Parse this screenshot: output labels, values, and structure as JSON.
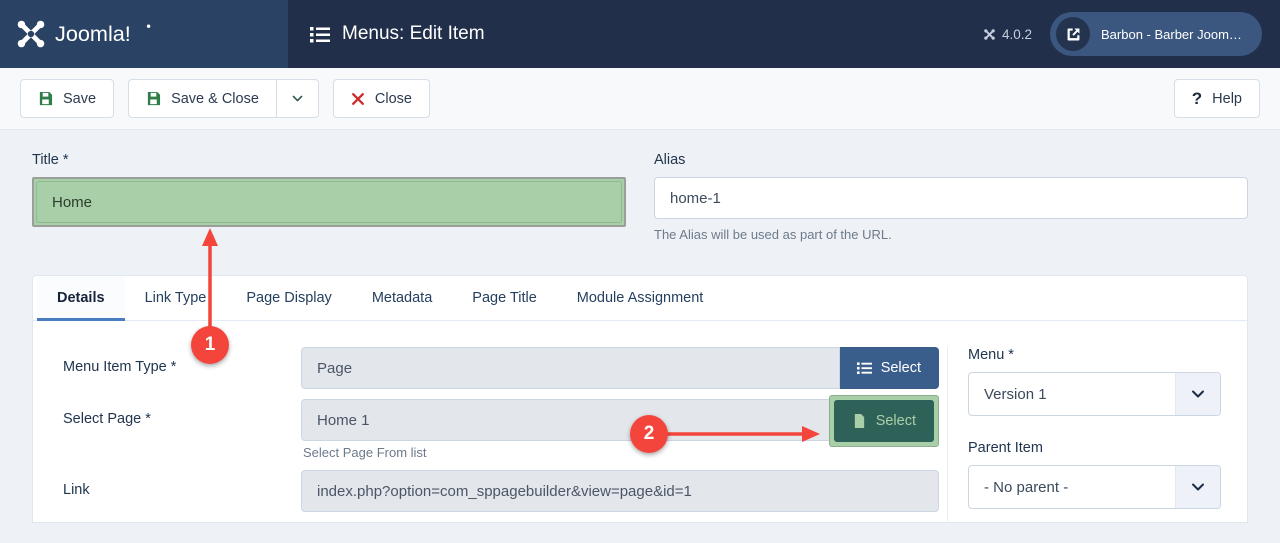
{
  "header": {
    "brand_name": "Joomla!",
    "brand_icon": "joomla-logo-icon",
    "page_title": "Menus: Edit Item",
    "page_title_icon": "list-icon",
    "version": "4.0.2",
    "version_icon": "joomla-mark-icon",
    "site_name": "Barbon - Barber Joomla Templ...",
    "site_icon": "external-link-icon"
  },
  "toolbar": {
    "save_label": "Save",
    "save_icon": "floppy-disk-icon",
    "save_close_label": "Save & Close",
    "save_close_icon": "floppy-disk-icon",
    "dropdown_icon": "chevron-down-icon",
    "close_label": "Close",
    "close_icon": "x-mark-icon",
    "help_label": "Help",
    "help_icon": "question-mark-icon"
  },
  "form": {
    "title_label": "Title *",
    "title_value": "Home",
    "title_placeholder": "Title",
    "alias_label": "Alias",
    "alias_value": "home-1",
    "alias_placeholder": "Alias",
    "alias_hint": "The Alias will be used as part of the URL."
  },
  "tabs": [
    {
      "label": "Details",
      "active": true
    },
    {
      "label": "Link Type",
      "active": false
    },
    {
      "label": "Page Display",
      "active": false
    },
    {
      "label": "Metadata",
      "active": false
    },
    {
      "label": "Page Title",
      "active": false
    },
    {
      "label": "Module Assignment",
      "active": false
    }
  ],
  "details": {
    "menu_item_type_label": "Menu Item Type *",
    "menu_item_type_value": "Page",
    "menu_item_type_select_label": "Select",
    "menu_item_type_select_icon": "list-icon",
    "select_page_label": "Select Page *",
    "select_page_value": "Home 1",
    "select_page_select_label": "Select",
    "select_page_select_icon": "file-icon",
    "select_page_hint": "Select Page From list",
    "link_label": "Link",
    "link_value": "index.php?option=com_sppagebuilder&view=page&id=1"
  },
  "sidebar": {
    "menu_label": "Menu *",
    "menu_value": "Version 1",
    "menu_caret_icon": "chevron-down-icon",
    "parent_label": "Parent Item",
    "parent_value": "- No parent -",
    "parent_caret_icon": "chevron-down-icon"
  },
  "annotations": [
    {
      "number": "1",
      "target": "title-field",
      "arrow": "up"
    },
    {
      "number": "2",
      "target": "select-page-select-button",
      "arrow": "right"
    }
  ],
  "colors": {
    "brand_blue": "#2a4365",
    "header_dark": "#212f4a",
    "accent_blue": "#3a5e8c",
    "tab_underline": "#4a7dc0",
    "highlight_green": "#a9cfa9",
    "highlight_teal": "#2e6158",
    "annotation_red": "#f4453c",
    "save_icon_green": "#2f7d49",
    "close_icon_red": "#cc2b2b",
    "page_bg": "#eef2f6"
  }
}
